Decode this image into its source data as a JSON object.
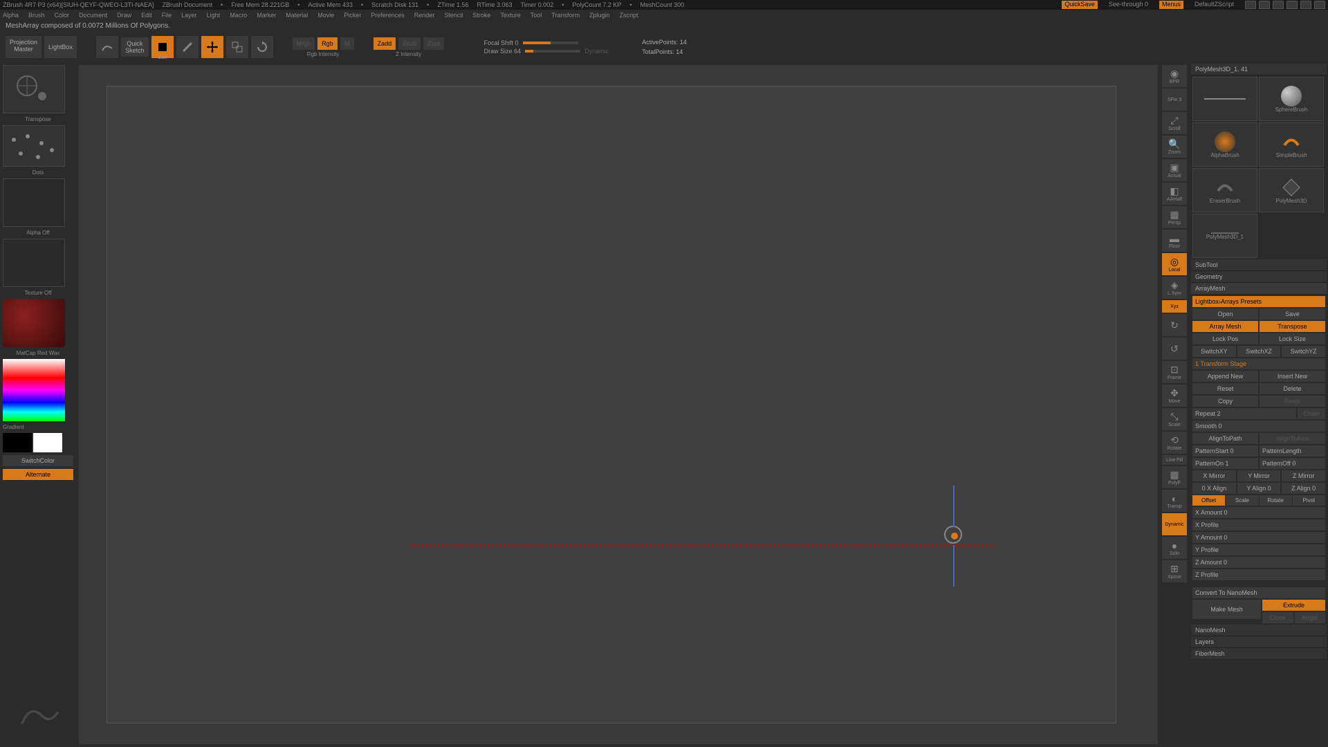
{
  "title": {
    "app": "ZBrush 4R7 P3 (x64)[SIUH-QEYF-QWEO-L3TI-NAEA]",
    "doc": "ZBrush Document",
    "freemem": "Free Mem 28.221GB",
    "activemem": "Active Mem 433",
    "scratch": "Scratch Disk 131",
    "ztime": "ZTime 1.56",
    "rtime": "RTime 3.063",
    "timer": "Timer 0.002",
    "polycount": "PolyCount 7.2 KP",
    "meshcount": "MeshCount 300",
    "quicksave": "QuickSave",
    "seethrough": "See-through  0",
    "menus": "Menus",
    "script": "DefaultZScript"
  },
  "menu": [
    "Alpha",
    "Brush",
    "Color",
    "Document",
    "Draw",
    "Edit",
    "File",
    "Layer",
    "Light",
    "Macro",
    "Marker",
    "Material",
    "Movie",
    "Picker",
    "Preferences",
    "Render",
    "Stencil",
    "Stroke",
    "Texture",
    "Tool",
    "Transform",
    "Zplugin",
    "Zscript"
  ],
  "status": "MeshArray composed of 0.0072 Millions Of Polygons.",
  "toolbar": {
    "projection": "Projection\nMaster",
    "lightbox": "LightBox",
    "quicksketch": "Quick\nSketch",
    "edit": "Edit",
    "draw": "Draw",
    "move": "Move",
    "scale": "Scale",
    "rotate": "Rotate",
    "mrgb": "Mrgb",
    "rgb": "Rgb",
    "m": "M",
    "rgbintensity": "Rgb Intensity",
    "zadd": "Zadd",
    "zsub": "Zsub",
    "zcut": "Zcut",
    "zintensity": "Z Intensity",
    "focalshift": "Focal Shift 0",
    "drawsize": "Draw Size 64",
    "dynamic": "Dynamic",
    "activepoints": "ActivePoints: 14",
    "totalpoints": "TotalPoints: 14"
  },
  "left": {
    "transpose": "Transpose",
    "dots": "Dots",
    "alpha": "Alpha Off",
    "texture": "Texture Off",
    "matcap": "MatCap Red Wax",
    "gradient": "Gradient",
    "switchcolor": "SwitchColor",
    "alternate": "Alternate"
  },
  "dock": {
    "bpr": "BPR",
    "spix": "SPix 3",
    "scroll": "Scroll",
    "zoom": "Zoom",
    "actual": "Actual",
    "aahalf": "AAHalf",
    "persp": "Persp",
    "floor": "Floor",
    "local": "Local",
    "lsym": "L.Sym",
    "xyz": "Xyz",
    "frame": "Frame",
    "move": "Move",
    "scale": "Scale",
    "rotate": "Rotate",
    "linefill": "Line Fill",
    "polyf": "PolyF",
    "transp": "Transp",
    "dynamic": "Dynamic",
    "solo": "Solo",
    "xpose": "Xpose"
  },
  "tools": {
    "header": "PolyMesh3D_1. 41",
    "thumbs": [
      "SphereBrush",
      "AlphaBrush",
      "SimpleBrush",
      "EraserBrush",
      "PolyMesh3D",
      "PolyMesh3D_1"
    ],
    "subtool": "SubTool",
    "geometry": "Geometry",
    "arraymesh": "ArrayMesh",
    "lightbox_presets": "Lightbox›Arrays Presets",
    "open": "Open",
    "save": "Save",
    "array_mesh": "Array Mesh",
    "transpose": "Transpose",
    "lock_pos": "Lock Pos",
    "lock_size": "Lock Size",
    "switchxy": "SwitchXY",
    "switchxz": "SwitchXZ",
    "switchyz": "SwitchYZ",
    "transform_stage": "1 Transform Stage",
    "append": "Append New",
    "insert": "Insert New",
    "reset": "Reset",
    "delete": "Delete",
    "copy": "Copy",
    "paste": "Paste",
    "repeat": "Repeat 2",
    "chain": "Chain",
    "smooth": "Smooth 0",
    "aligntopath": "AlignToPath",
    "aligntoaxis": "AlignToAxis",
    "patternstart": "PatternStart 0",
    "patternlength": "PatternLength",
    "patternon": "PatternOn 1",
    "patternoff": "PatternOff 0",
    "xmirror": "X Mirror",
    "ymirror": "Y Mirror",
    "zmirror": "Z Mirror",
    "xalign": "0 X Align",
    "yalign": "Y Align 0",
    "zalign": "Z Align 0",
    "offset": "Offset",
    "scale": "Scale",
    "rotate": "Rotate",
    "pivot": "Pivot",
    "xamount": "X Amount 0",
    "xprofile": "X Profile",
    "yamount": "Y Amount 0",
    "yprofile": "Y Profile",
    "zamount": "Z Amount 0",
    "zprofile": "Z Profile",
    "convert": "Convert To NanoMesh",
    "makemesh": "Make Mesh",
    "extrude": "Extrude",
    "close": "Close",
    "angle": "Angle",
    "nanomesh": "NanoMesh",
    "layers": "Layers",
    "fibermesh": "FiberMesh"
  }
}
